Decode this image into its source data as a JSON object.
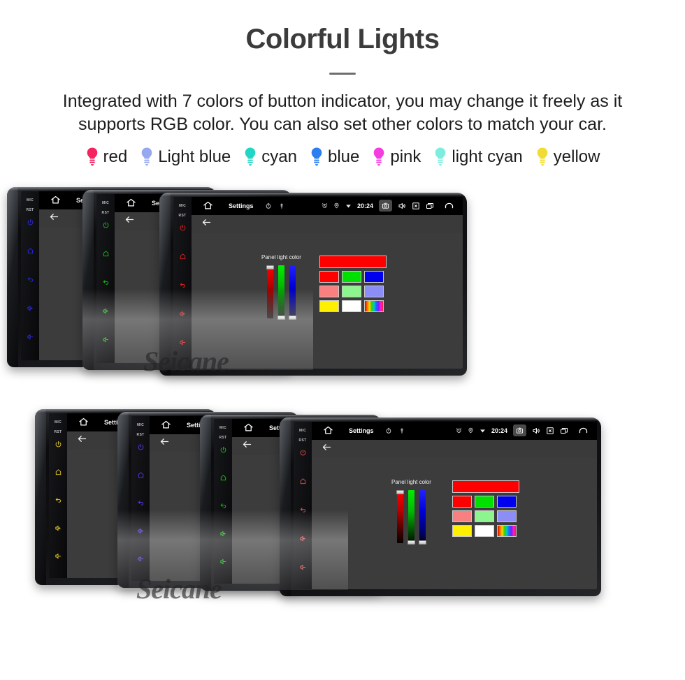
{
  "header": {
    "title": "Colorful Lights",
    "subtitle": "Integrated with 7 colors of button indicator, you may change it freely as it supports RGB color. You can also set other colors to match your car."
  },
  "legend": {
    "items": [
      {
        "label": "red",
        "color": "#f4225e",
        "icon": "bulb-icon"
      },
      {
        "label": "Light blue",
        "color": "#96a8f0",
        "icon": "bulb-icon"
      },
      {
        "label": "cyan",
        "color": "#21d6c4",
        "icon": "bulb-icon"
      },
      {
        "label": "blue",
        "color": "#2a7ef0",
        "icon": "bulb-icon"
      },
      {
        "label": "pink",
        "color": "#f43ce0",
        "icon": "bulb-icon"
      },
      {
        "label": "light cyan",
        "color": "#7deede",
        "icon": "bulb-icon"
      },
      {
        "label": "yellow",
        "color": "#f0dc32",
        "icon": "bulb-icon"
      }
    ]
  },
  "device": {
    "status_bar": {
      "title": "Settings",
      "clock": "20:24",
      "left_icons": [
        "home-icon",
        "timer-icon",
        "usb-icon"
      ],
      "right_icons": [
        "alarm-icon",
        "location-icon",
        "wifi-icon",
        "camera-icon",
        "volume-icon",
        "close-box-icon",
        "recents-icon",
        "back-arrow-icon"
      ],
      "camera_highlighted": true
    },
    "key_strip": {
      "labels": [
        "MIC",
        "RST"
      ],
      "keys": [
        "power-icon",
        "home-key-icon",
        "back-key-icon",
        "volume-up-icon",
        "volume-down-icon"
      ]
    },
    "action_bar": {
      "icon": "back-arrow-icon"
    },
    "panel": {
      "label": "Panel light color",
      "sliders": [
        {
          "name": "red-slider",
          "handle": "top"
        },
        {
          "name": "green-slider",
          "handle": "bottom"
        },
        {
          "name": "blue-slider",
          "handle": "bottom"
        }
      ],
      "preview_color": "#ff0000",
      "swatch_rows": [
        [
          "#ff0000",
          "#00e000",
          "#0000ee"
        ],
        [
          "#f98080",
          "#8df58d",
          "#8d8df8"
        ],
        [
          "#ffef00",
          "#ffffff",
          "rainbow"
        ]
      ]
    }
  },
  "groups": {
    "top": {
      "name": "top-device-stack",
      "units": [
        {
          "name": "device-blue",
          "key_color": "#2a2ae8"
        },
        {
          "name": "device-green",
          "key_color": "#18c018"
        },
        {
          "name": "device-red",
          "key_color": "#e02020"
        }
      ]
    },
    "bottom": {
      "name": "bottom-device-stack",
      "units": [
        {
          "name": "device-yellow",
          "key_color": "#e8c820"
        },
        {
          "name": "device-violet",
          "key_color": "#5a3ae8"
        },
        {
          "name": "device-green",
          "key_color": "#18c018"
        },
        {
          "name": "device-red",
          "key_color": "#e05050"
        }
      ]
    }
  },
  "watermark": {
    "text": "Seicane"
  }
}
